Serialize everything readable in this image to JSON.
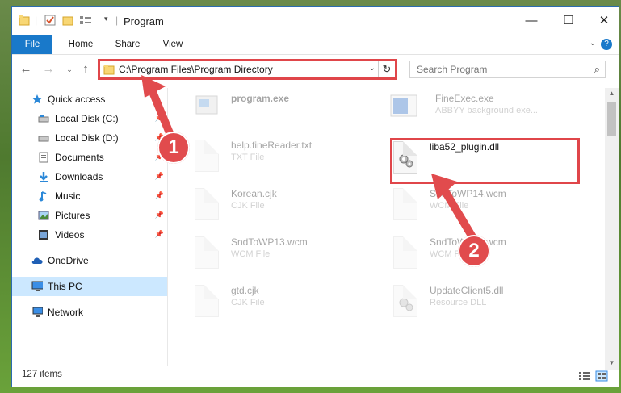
{
  "window": {
    "title": "Program",
    "minimize": "—",
    "maximize": "☐",
    "close": "✕"
  },
  "ribbon": {
    "tabs": [
      "File",
      "Home",
      "Share",
      "View"
    ],
    "help": "?"
  },
  "address": {
    "path": "C:\\Program Files\\Program Directory",
    "search_placeholder": "Search Program"
  },
  "sidebar": {
    "items": [
      {
        "label": "Quick access",
        "icon": "star-icon"
      },
      {
        "label": "Local Disk (C:)",
        "icon": "drive-icon"
      },
      {
        "label": "Local Disk (D:)",
        "icon": "drive-icon"
      },
      {
        "label": "Documents",
        "icon": "documents-icon"
      },
      {
        "label": "Downloads",
        "icon": "download-icon"
      },
      {
        "label": "Music",
        "icon": "music-icon"
      },
      {
        "label": "Pictures",
        "icon": "pictures-icon"
      },
      {
        "label": "Videos",
        "icon": "videos-icon"
      },
      {
        "label": "OneDrive",
        "icon": "cloud-icon"
      },
      {
        "label": "This PC",
        "icon": "pc-icon"
      },
      {
        "label": "Network",
        "icon": "network-icon"
      }
    ]
  },
  "files": [
    {
      "name": "program.exe",
      "type": ""
    },
    {
      "name": "FineExec.exe",
      "type": "ABBYY background exe..."
    },
    {
      "name": "help.fineReader.txt",
      "type": "TXT File"
    },
    {
      "name": "liba52_plugin.dll",
      "type": ""
    },
    {
      "name": "Korean.cjk",
      "type": "CJK File"
    },
    {
      "name": "SndToWP14.wcm",
      "type": "WCM File"
    },
    {
      "name": "SndToWP13.wcm",
      "type": "WCM File"
    },
    {
      "name": "SndToWP12.wcm",
      "type": "WCM File"
    },
    {
      "name": "gtd.cjk",
      "type": "CJK File"
    },
    {
      "name": "UpdateClient5.dll",
      "type": "Resource DLL"
    }
  ],
  "annotations": {
    "step1": "1",
    "step2": "2"
  },
  "status": {
    "items": "127 items"
  },
  "colors": {
    "accent": "#1979ca",
    "highlight": "#e0464a",
    "selected": "#cce8ff"
  }
}
